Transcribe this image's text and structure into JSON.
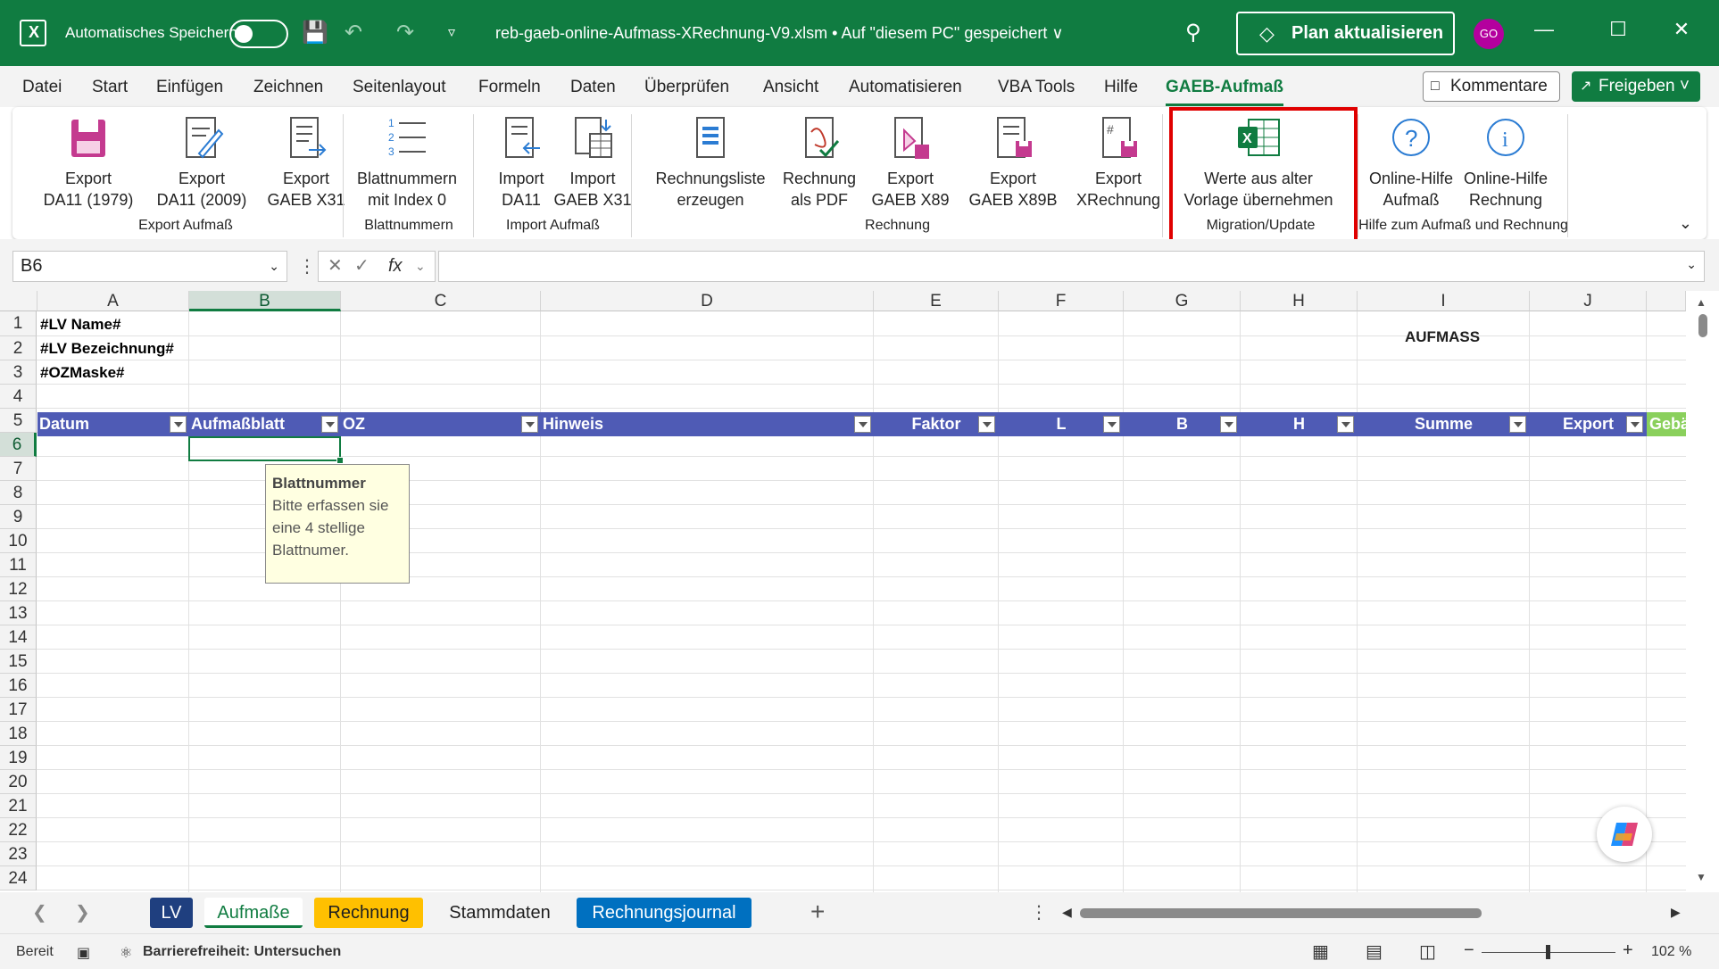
{
  "titlebar": {
    "autosave_label": "Automatisches Speichern",
    "filename": "reb-gaeb-online-Aufmass-XRechnung-V9.xlsm • Auf \"diesem PC\" gespeichert ∨",
    "plan_button": "Plan aktualisieren",
    "avatar": "GO"
  },
  "menu": {
    "tabs": [
      "Datei",
      "Start",
      "Einfügen",
      "Zeichnen",
      "Seitenlayout",
      "Formeln",
      "Daten",
      "Überprüfen",
      "Ansicht",
      "Automatisieren",
      "VBA Tools",
      "Hilfe",
      "GAEB-Aufmaß"
    ],
    "active_tab": "GAEB-Aufmaß",
    "kommentare": "Kommentare",
    "freigeben": "Freigeben ˅"
  },
  "ribbon": {
    "buttons": [
      {
        "line1": "Export",
        "line2": "DA11 (1979)"
      },
      {
        "line1": "Export",
        "line2": "DA11 (2009)"
      },
      {
        "line1": "Export",
        "line2": "GAEB X31"
      },
      {
        "line1": "Blattnummern",
        "line2": "mit Index 0"
      },
      {
        "line1": "Import",
        "line2": "DA11"
      },
      {
        "line1": "Import",
        "line2": "GAEB X31"
      },
      {
        "line1": "Rechnungsliste",
        "line2": "erzeugen"
      },
      {
        "line1": "Rechnung",
        "line2": "als PDF"
      },
      {
        "line1": "Export",
        "line2": "GAEB X89"
      },
      {
        "line1": "Export",
        "line2": "GAEB X89B"
      },
      {
        "line1": "Export",
        "line2": "XRechnung"
      },
      {
        "line1": "Werte aus alter",
        "line2": "Vorlage übernehmen"
      },
      {
        "line1": "Online-Hilfe",
        "line2": "Aufmaß"
      },
      {
        "line1": "Online-Hilfe",
        "line2": "Rechnung"
      }
    ],
    "groups": [
      "Export Aufmaß",
      "Blattnummern",
      "Import Aufmaß",
      "Rechnung",
      "Migration/Update",
      "Hilfe zum Aufmaß und Rechnung"
    ]
  },
  "formula_bar": {
    "name_box": "B6",
    "fx": "fx",
    "formula": ""
  },
  "grid": {
    "columns": [
      "A",
      "B",
      "C",
      "D",
      "E",
      "F",
      "G",
      "H",
      "I",
      "J"
    ],
    "rows": [
      "1",
      "2",
      "3",
      "4",
      "5",
      "6",
      "7",
      "8",
      "9",
      "10",
      "11",
      "12",
      "13",
      "14",
      "15",
      "16",
      "17",
      "18",
      "19",
      "20",
      "21",
      "22",
      "23",
      "24"
    ],
    "selected_column": "B",
    "selected_row": "6",
    "cells": {
      "a1": "#LV Name#",
      "a2": "#LV Bezeichnung#",
      "a3": "#OZMaske#",
      "aufmass_title": "AUFMASS"
    },
    "header_row": [
      "Datum",
      "Aufmaßblatt",
      "OZ",
      "Hinweis",
      "Faktor",
      "L",
      "B",
      "H",
      "Summe",
      "Export",
      "Gebä"
    ],
    "header_color": "#4f5bb5",
    "tooltip": {
      "title": "Blattnummer",
      "lines": [
        "Bitte erfassen sie",
        "eine 4 stellige",
        "Blattnumer."
      ]
    }
  },
  "sheets": {
    "tabs": [
      {
        "label": "LV",
        "color": "#1f3f7f"
      },
      {
        "label": "Aufmaße",
        "color": ""
      },
      {
        "label": "Rechnung",
        "color": "#ffc000"
      },
      {
        "label": "Stammdaten",
        "color": ""
      },
      {
        "label": "Rechnungsjournal",
        "color": "#0070c0"
      }
    ],
    "active": "Aufmaße"
  },
  "status": {
    "ready": "Bereit",
    "accessibility": "Barrierefreiheit: Untersuchen",
    "zoom": "102 %"
  }
}
